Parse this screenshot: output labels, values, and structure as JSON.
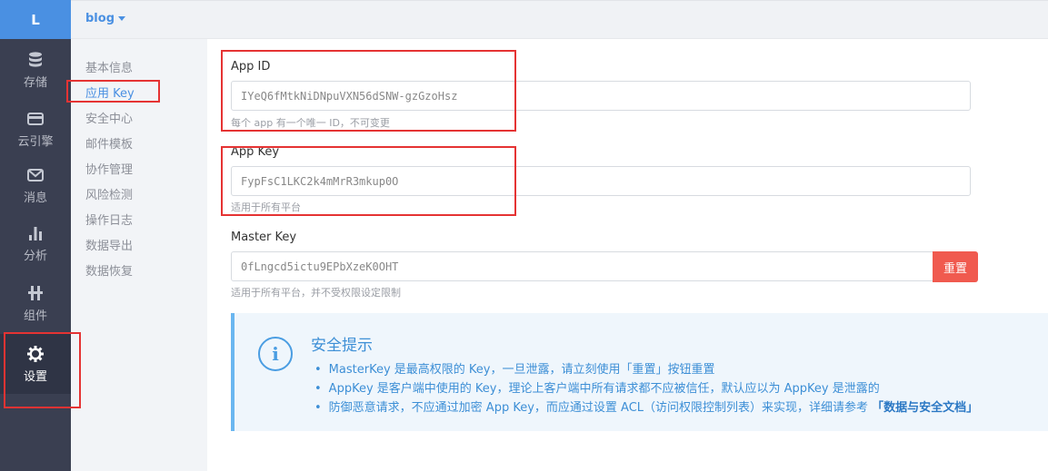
{
  "rail": {
    "logo": "L",
    "items": [
      {
        "label": "存储",
        "icon": "database-icon"
      },
      {
        "label": "云引擎",
        "icon": "cloud-engine-icon"
      },
      {
        "label": "消息",
        "icon": "message-icon"
      },
      {
        "label": "分析",
        "icon": "bar-chart-icon"
      },
      {
        "label": "组件",
        "icon": "components-icon"
      },
      {
        "label": "设置",
        "icon": "gear-icon"
      }
    ]
  },
  "topbar": {
    "app_name": "blog"
  },
  "subnav": {
    "items": [
      "基本信息",
      "应用 Key",
      "安全中心",
      "邮件模板",
      "协作管理",
      "风险检测",
      "操作日志",
      "数据导出",
      "数据恢复"
    ]
  },
  "fields": {
    "app_id": {
      "label": "App ID",
      "value": "IYeQ6fMtkNiDNpuVXN56dSNW-gzGzoHsz",
      "help": "每个 app 有一个唯一 ID，不可变更"
    },
    "app_key": {
      "label": "App Key",
      "value": "FypFsC1LKC2k4mMrR3mkup0O",
      "help": "适用于所有平台"
    },
    "master_key": {
      "label": "Master Key",
      "value": "0fLngcd5ictu9EPbXzeK0OHT",
      "help": "适用于所有平台，并不受权限设定限制",
      "reset_label": "重置"
    }
  },
  "tip": {
    "title": "安全提示",
    "items": [
      "MasterKey 是最高权限的 Key，一旦泄露，请立刻使用「重置」按钮重置",
      "AppKey 是客户端中使用的 Key，理论上客户端中所有请求都不应被信任，默认应以为 AppKey 是泄露的",
      "防御恶意请求，不应通过加密 App Key，而应通过设置 ACL（访问权限控制列表）来实现，详细请参考 "
    ],
    "doc_link": "「数据与安全文档」"
  }
}
